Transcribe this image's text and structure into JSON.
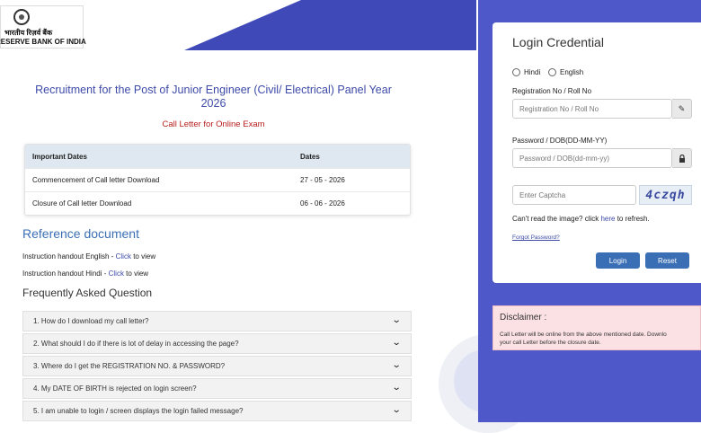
{
  "logo": {
    "hindi_text": "भारतीय रिज़र्व बैंक",
    "english_text": "RESERVE BANK OF INDIA"
  },
  "page": {
    "title": "Recruitment for the Post of Junior Engineer (Civil/ Electrical) Panel Year 2026",
    "subtitle": "Call Letter for Online Exam"
  },
  "dates_table": {
    "headers": [
      "Important Dates",
      "Dates"
    ],
    "rows": [
      {
        "label": "Commencement of Call letter Download",
        "date": "27 - 05 - 2026"
      },
      {
        "label": "Closure of Call letter Download",
        "date": "06 - 06 - 2026"
      }
    ]
  },
  "reference": {
    "title": "Reference document",
    "items": [
      {
        "prefix": "Instruction handout English - ",
        "link": "Click",
        "suffix": " to view"
      },
      {
        "prefix": "Instruction handout Hindi - ",
        "link": "Click",
        "suffix": " to view"
      }
    ]
  },
  "faq": {
    "title": "Frequently Asked Question",
    "items": [
      "1. How do I download my call letter?",
      "2. What should I do if there is lot of delay in accessing the page?",
      "3. Where do I get the REGISTRATION NO. & PASSWORD?",
      "4. My DATE OF BIRTH is rejected on login screen?",
      "5. I am unable to login / screen displays the login failed message?"
    ]
  },
  "login": {
    "title": "Login Credential",
    "lang_hindi": "Hindi",
    "lang_english": "English",
    "reg_label": "Registration No / Roll No",
    "reg_placeholder": "Registration No / Roll No",
    "pwd_label": "Password / DOB(DD-MM-YY)",
    "pwd_placeholder": "Password / DOB(dd-mm-yy)",
    "captcha_placeholder": "Enter Captcha",
    "captcha_text": "4czqh",
    "refresh_prefix": "Can't read the image? click ",
    "refresh_link": "here",
    "refresh_suffix": " to refresh.",
    "forgot": "Forgot Password?",
    "login_button": "Login",
    "reset_button": "Reset"
  },
  "disclaimer": {
    "title": "Disclaimer :",
    "line1": "Call Letter will be online from the above mentioned date. Downlo",
    "line2": "your call Letter before the closure date."
  },
  "colors": {
    "accent": "#4e58c8",
    "title_blue": "#3d4aa8",
    "subtitle_red": "#b81c1c",
    "button_blue": "#3b6fb5",
    "disclaimer_bg": "#fbe1e4"
  },
  "icons": {
    "reg_field": "pencil-icon",
    "pwd_field": "lock-icon",
    "faq_toggle": "chevron-down-icon"
  }
}
